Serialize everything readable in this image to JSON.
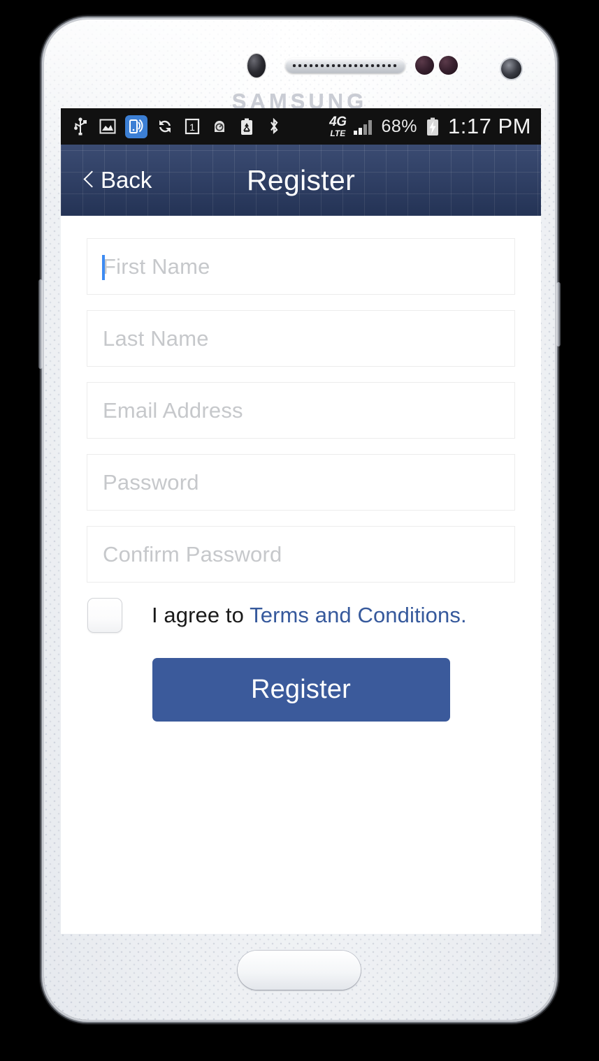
{
  "device": {
    "brand": "SAMSUNG"
  },
  "status_bar": {
    "icons": [
      "usb-icon",
      "screenshot-image-icon",
      "mobile-hotspot-icon",
      "sync-icon",
      "calendar-day-icon",
      "padlock-icon",
      "battery-saver-recycle-icon",
      "bluetooth-icon"
    ],
    "network_type": "4G",
    "network_sub": "LTE",
    "signal_bars": 2,
    "signal_bars_total": 4,
    "battery_percent": "68%",
    "battery_state": "charging",
    "time": "1:17 PM"
  },
  "header": {
    "back_label": "Back",
    "back_icon": "chevron-left-icon",
    "title": "Register",
    "background_color": "#2c3e68"
  },
  "form": {
    "fields": [
      {
        "name": "first-name",
        "placeholder": "First Name",
        "value": "",
        "focused": true
      },
      {
        "name": "last-name",
        "placeholder": "Last Name",
        "value": "",
        "focused": false
      },
      {
        "name": "email",
        "placeholder": "Email Address",
        "value": "",
        "focused": false
      },
      {
        "name": "password",
        "placeholder": "Password",
        "value": "",
        "focused": false
      },
      {
        "name": "confirm-password",
        "placeholder": "Confirm Password",
        "value": "",
        "focused": false
      }
    ],
    "terms": {
      "checked": false,
      "prefix": "I agree to ",
      "link_text": "Terms and Conditions.",
      "link_color": "#36599c"
    },
    "submit": {
      "label": "Register",
      "color": "#3b5a9b"
    }
  }
}
